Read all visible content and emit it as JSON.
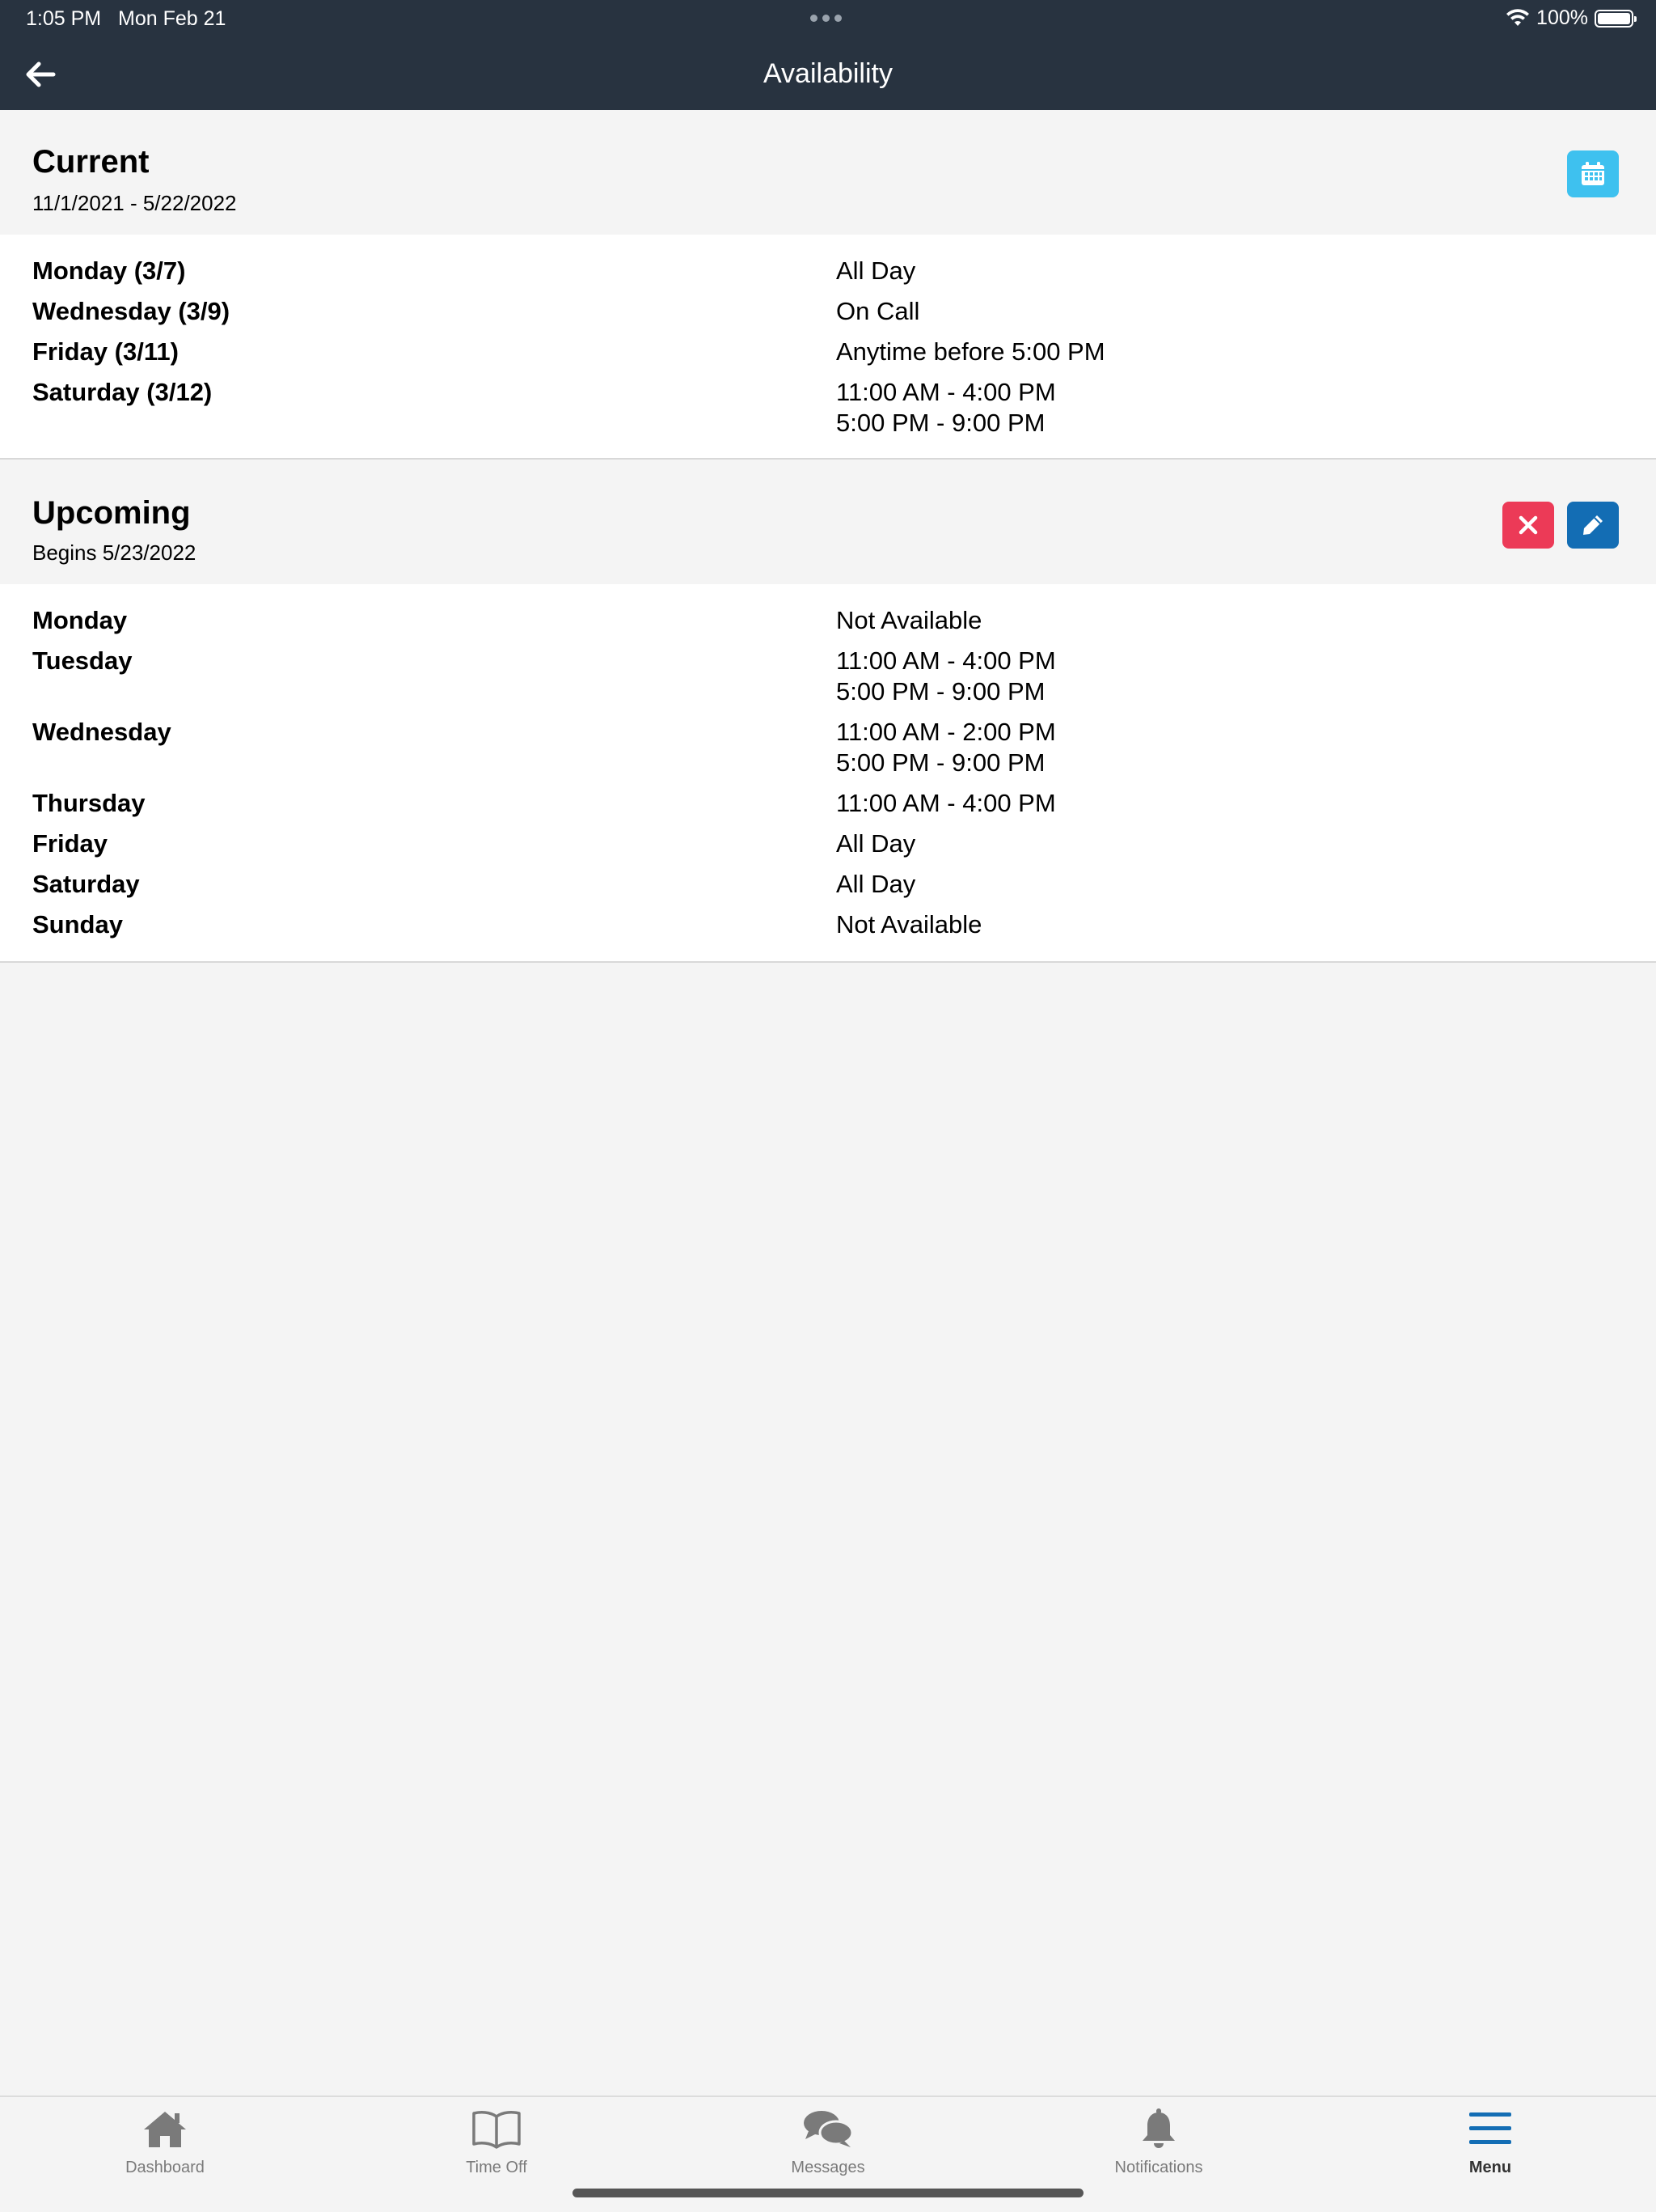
{
  "status_bar": {
    "time": "1:05 PM",
    "date": "Mon Feb 21",
    "battery": "100%"
  },
  "nav": {
    "title": "Availability"
  },
  "current": {
    "heading": "Current",
    "range": "11/1/2021 - 5/22/2022",
    "rows": [
      {
        "day": "Monday (3/7)",
        "times": [
          "All Day"
        ]
      },
      {
        "day": "Wednesday (3/9)",
        "times": [
          "On Call"
        ]
      },
      {
        "day": "Friday (3/11)",
        "times": [
          "Anytime before 5:00 PM"
        ]
      },
      {
        "day": "Saturday (3/12)",
        "times": [
          "11:00 AM - 4:00 PM",
          "5:00 PM - 9:00 PM"
        ]
      }
    ]
  },
  "upcoming": {
    "heading": "Upcoming",
    "begins": "Begins 5/23/2022",
    "rows": [
      {
        "day": "Monday",
        "times": [
          "Not Available"
        ]
      },
      {
        "day": "Tuesday",
        "times": [
          "11:00 AM - 4:00 PM",
          "5:00 PM - 9:00 PM"
        ]
      },
      {
        "day": "Wednesday",
        "times": [
          "11:00 AM - 2:00 PM",
          "5:00 PM - 9:00 PM"
        ]
      },
      {
        "day": "Thursday",
        "times": [
          "11:00 AM - 4:00 PM"
        ]
      },
      {
        "day": "Friday",
        "times": [
          "All Day"
        ]
      },
      {
        "day": "Saturday",
        "times": [
          "All Day"
        ]
      },
      {
        "day": "Sunday",
        "times": [
          "Not Available"
        ]
      }
    ]
  },
  "tabs": [
    {
      "label": "Dashboard",
      "icon": "home-icon"
    },
    {
      "label": "Time Off",
      "icon": "book-icon"
    },
    {
      "label": "Messages",
      "icon": "chat-bubbles-icon"
    },
    {
      "label": "Notifications",
      "icon": "bell-icon"
    },
    {
      "label": "Menu",
      "icon": "hamburger-icon"
    }
  ],
  "colors": {
    "header": "#283340",
    "calendar_button": "#3ec1ef",
    "delete_button": "#ec3a57",
    "edit_button": "#136db4",
    "active_tab": "#136db4"
  }
}
